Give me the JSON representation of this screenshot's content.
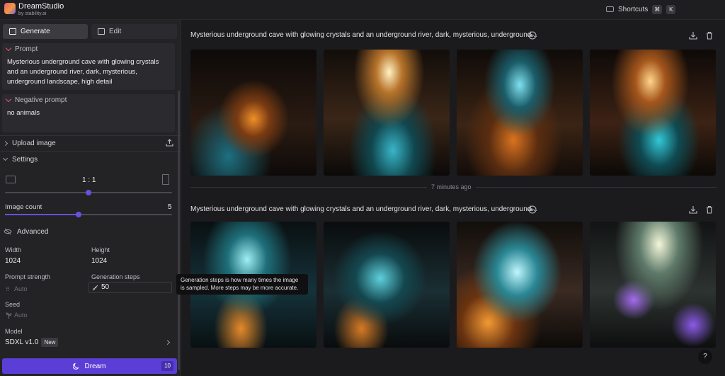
{
  "app": {
    "name": "DreamStudio",
    "byline": "by stability.ai"
  },
  "header": {
    "shortcuts_label": "Shortcuts",
    "shortcut_keys": [
      "⌘",
      "K"
    ]
  },
  "sidebar": {
    "tabs": [
      {
        "label": "Generate",
        "active": true
      },
      {
        "label": "Edit",
        "active": false
      }
    ],
    "prompt": {
      "label": "Prompt",
      "value": "Mysterious underground cave with glowing crystals and an underground river, dark, mysterious, underground landscape, high detail"
    },
    "negative_prompt": {
      "label": "Negative prompt",
      "value": "no animals"
    },
    "upload_image": "Upload image",
    "settings": {
      "label": "Settings",
      "aspect_ratio": "1 : 1",
      "aspect_slider_fraction": 0.5,
      "image_count_label": "Image count",
      "image_count": "5",
      "image_count_fraction": 0.44
    },
    "advanced": {
      "label": "Advanced",
      "width_label": "Width",
      "width": "1024",
      "height_label": "Height",
      "height": "1024",
      "prompt_strength_label": "Prompt strength",
      "prompt_strength": "Auto",
      "generation_steps_label": "Generation steps",
      "generation_steps": "50",
      "seed_label": "Seed",
      "seed": "Auto"
    },
    "model": {
      "label": "Model",
      "value": "SDXL v1.0",
      "badge": "New"
    },
    "dream_button": {
      "label": "Dream",
      "credits": "10"
    }
  },
  "tooltip": "Generation steps is how many times the image is sampled. More steps may be more accurate.",
  "main": {
    "generations": [
      {
        "title": "Mysterious underground cave with glowing crystals and an underground river, dark, mysterious, underground...",
        "image_count": 4,
        "palette": "warm"
      },
      {
        "title": "Mysterious underground cave with glowing crystals and an underground river, dark, mysterious, underground...",
        "image_count": 4,
        "palette": "cool"
      }
    ],
    "separator_label": "7 minutes ago"
  },
  "help_label": "?",
  "colors": {
    "accent": "#5b3ed6",
    "background": "#1b1b1e",
    "sidebar": "#232326",
    "prompt_chevron": "#e05a6a"
  }
}
